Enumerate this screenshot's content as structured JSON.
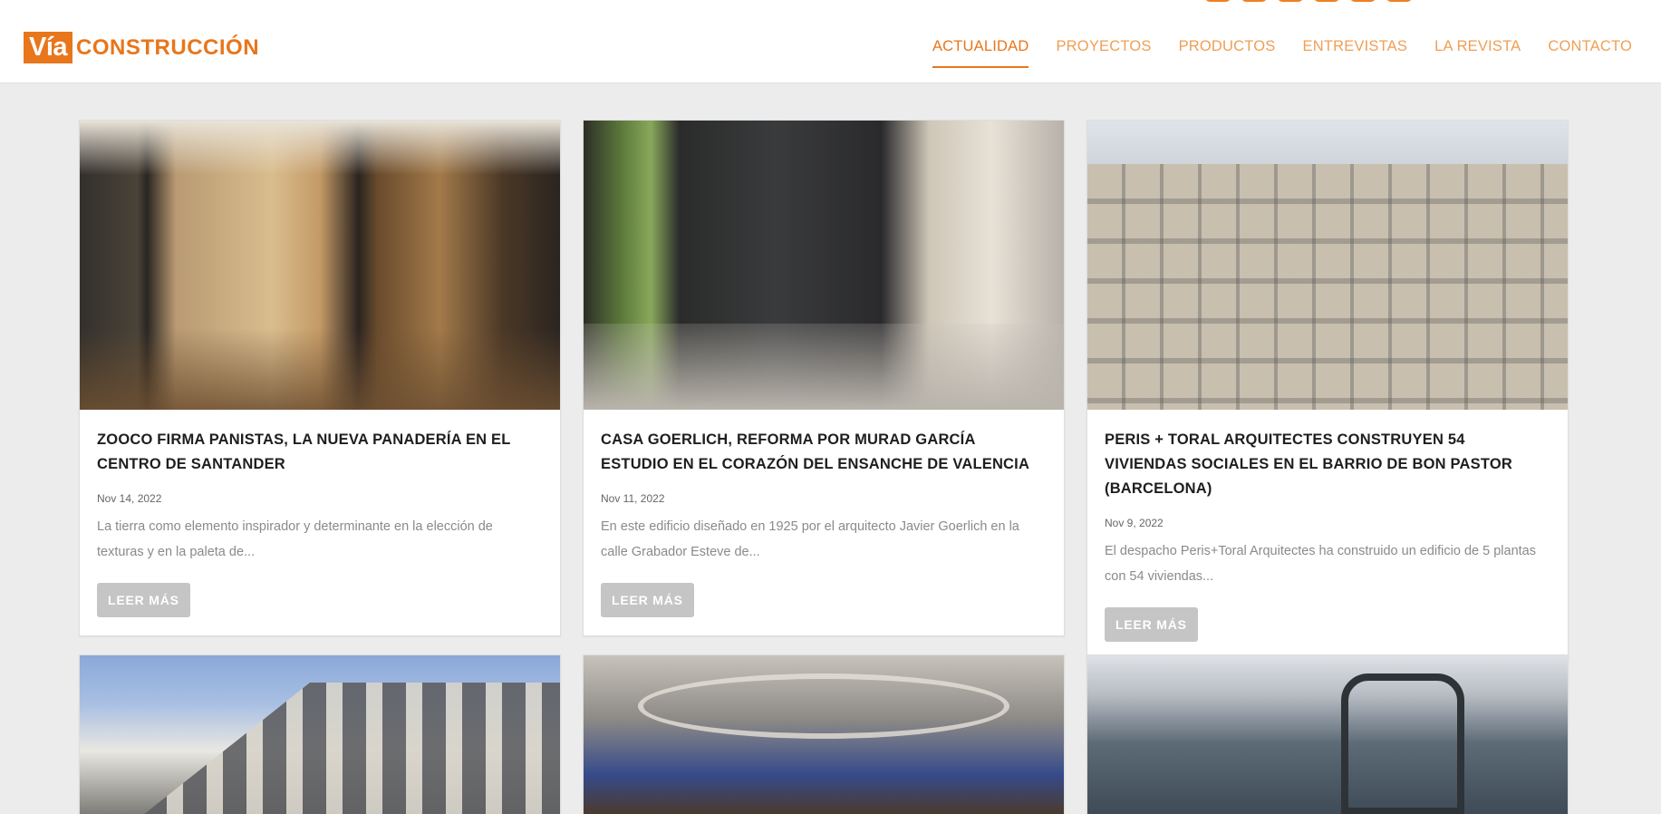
{
  "header": {
    "logo_via": "Vía",
    "logo_construccion": "CONSTRUCCIÓN",
    "nav": [
      {
        "label": "ACTUALIDAD",
        "active": true
      },
      {
        "label": "PROYECTOS",
        "active": false
      },
      {
        "label": "PRODUCTOS",
        "active": false
      },
      {
        "label": "ENTREVISTAS",
        "active": false
      },
      {
        "label": "LA REVISTA",
        "active": false
      },
      {
        "label": "CONTACTO",
        "active": false
      }
    ],
    "social_icon_count": 6,
    "accent_color": "#e8761b"
  },
  "posts": [
    {
      "image": "bakery-interior",
      "title": "ZOOCO FIRMA PANISTAS, LA NUEVA PANADERÍA EN EL CENTRO DE SANTANDER",
      "date": "Nov 14, 2022",
      "excerpt": "La tierra como elemento inspirador y determinante en la elección de texturas y en la paleta de...",
      "button": "LEER MÁS"
    },
    {
      "image": "office-interior",
      "title": "CASA GOERLICH, REFORMA POR MURAD GARCÍA ESTUDIO EN EL CORAZÓN DEL ENSANCHE DE VALENCIA",
      "date": "Nov 11, 2022",
      "excerpt": "En este edificio diseñado en 1925 por el arquitecto Javier Goerlich en la calle Grabador Esteve de...",
      "button": "LEER MÁS"
    },
    {
      "image": "housing-facade",
      "title": "PERIS + TORAL ARQUITECTES CONSTRUYEN 54 VIVIENDAS SOCIALES EN EL BARRIO DE BON PASTOR (BARCELONA)",
      "date": "Nov 9, 2022",
      "excerpt": "El despacho Peris+Toral Arquitectes ha construido un edificio de 5 plantas con 54 viviendas...",
      "button": "LEER MÁS"
    },
    {
      "image": "residential-building"
    },
    {
      "image": "arched-interior"
    },
    {
      "image": "glass-office"
    }
  ]
}
